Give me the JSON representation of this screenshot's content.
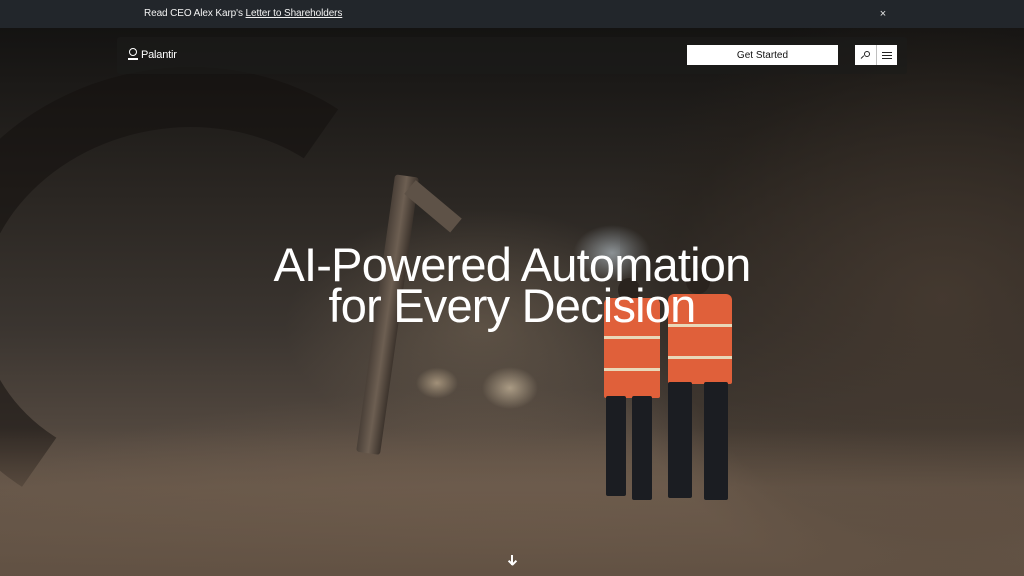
{
  "announcement": {
    "prefix": "Read CEO Alex Karp's ",
    "link_text": "Letter to Shareholders",
    "close_label": "×"
  },
  "nav": {
    "logo_text": "Palantir",
    "get_started_label": "Get Started",
    "search_icon": "search-icon",
    "menu_icon": "hamburger-menu-icon"
  },
  "hero": {
    "headline_line1": "AI-Powered Automation",
    "headline_line2": "for Every Decision",
    "scroll_icon": "arrow-down-icon"
  }
}
